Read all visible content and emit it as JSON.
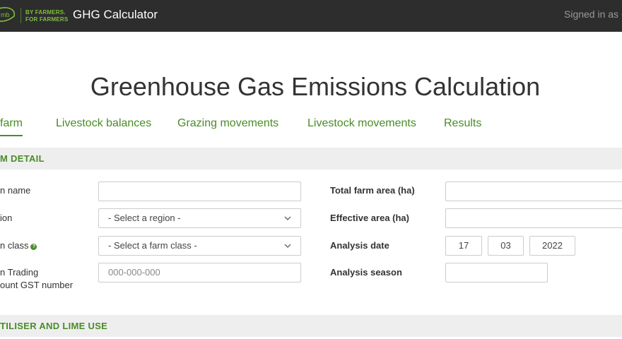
{
  "header": {
    "logo_text": "mb",
    "tagline_line1": "BY FARMERS.",
    "tagline_line2": "FOR FARMERS",
    "app_title": "GHG Calculator",
    "signed_in": "Signed in as C"
  },
  "page": {
    "title": "Greenhouse Gas Emissions Calculation"
  },
  "tabs": [
    {
      "label": "farm",
      "active": true
    },
    {
      "label": "Livestock balances"
    },
    {
      "label": "Grazing movements"
    },
    {
      "label": "Livestock movements"
    },
    {
      "label": "Results"
    }
  ],
  "farm_detail": {
    "section_title": "M DETAIL",
    "farm_name_label": "n name",
    "farm_name_value": "",
    "region_label": "ion",
    "region_value": "- Select a region -",
    "farm_class_label": "n class",
    "farm_class_value": "- Select a farm class -",
    "gst_label_line1": "n Trading",
    "gst_label_line2": "ount GST number",
    "gst_placeholder": "000-000-000",
    "total_area_label": "Total farm area (ha)",
    "total_area_value": "",
    "effective_area_label": "Effective area (ha)",
    "effective_area_value": "",
    "analysis_date_label": "Analysis date",
    "analysis_date_day": "17",
    "analysis_date_month": "03",
    "analysis_date_year": "2022",
    "analysis_season_label": "Analysis season",
    "analysis_season_value": ""
  },
  "fertiliser": {
    "section_title": "TILISER AND LIME USE"
  },
  "colors": {
    "accent": "#4a8c26",
    "topbar": "#2d2d2d",
    "section_bg": "#eeeeee"
  },
  "icons": {
    "help": "help-icon",
    "dropdown": "chevron-down-icon"
  }
}
